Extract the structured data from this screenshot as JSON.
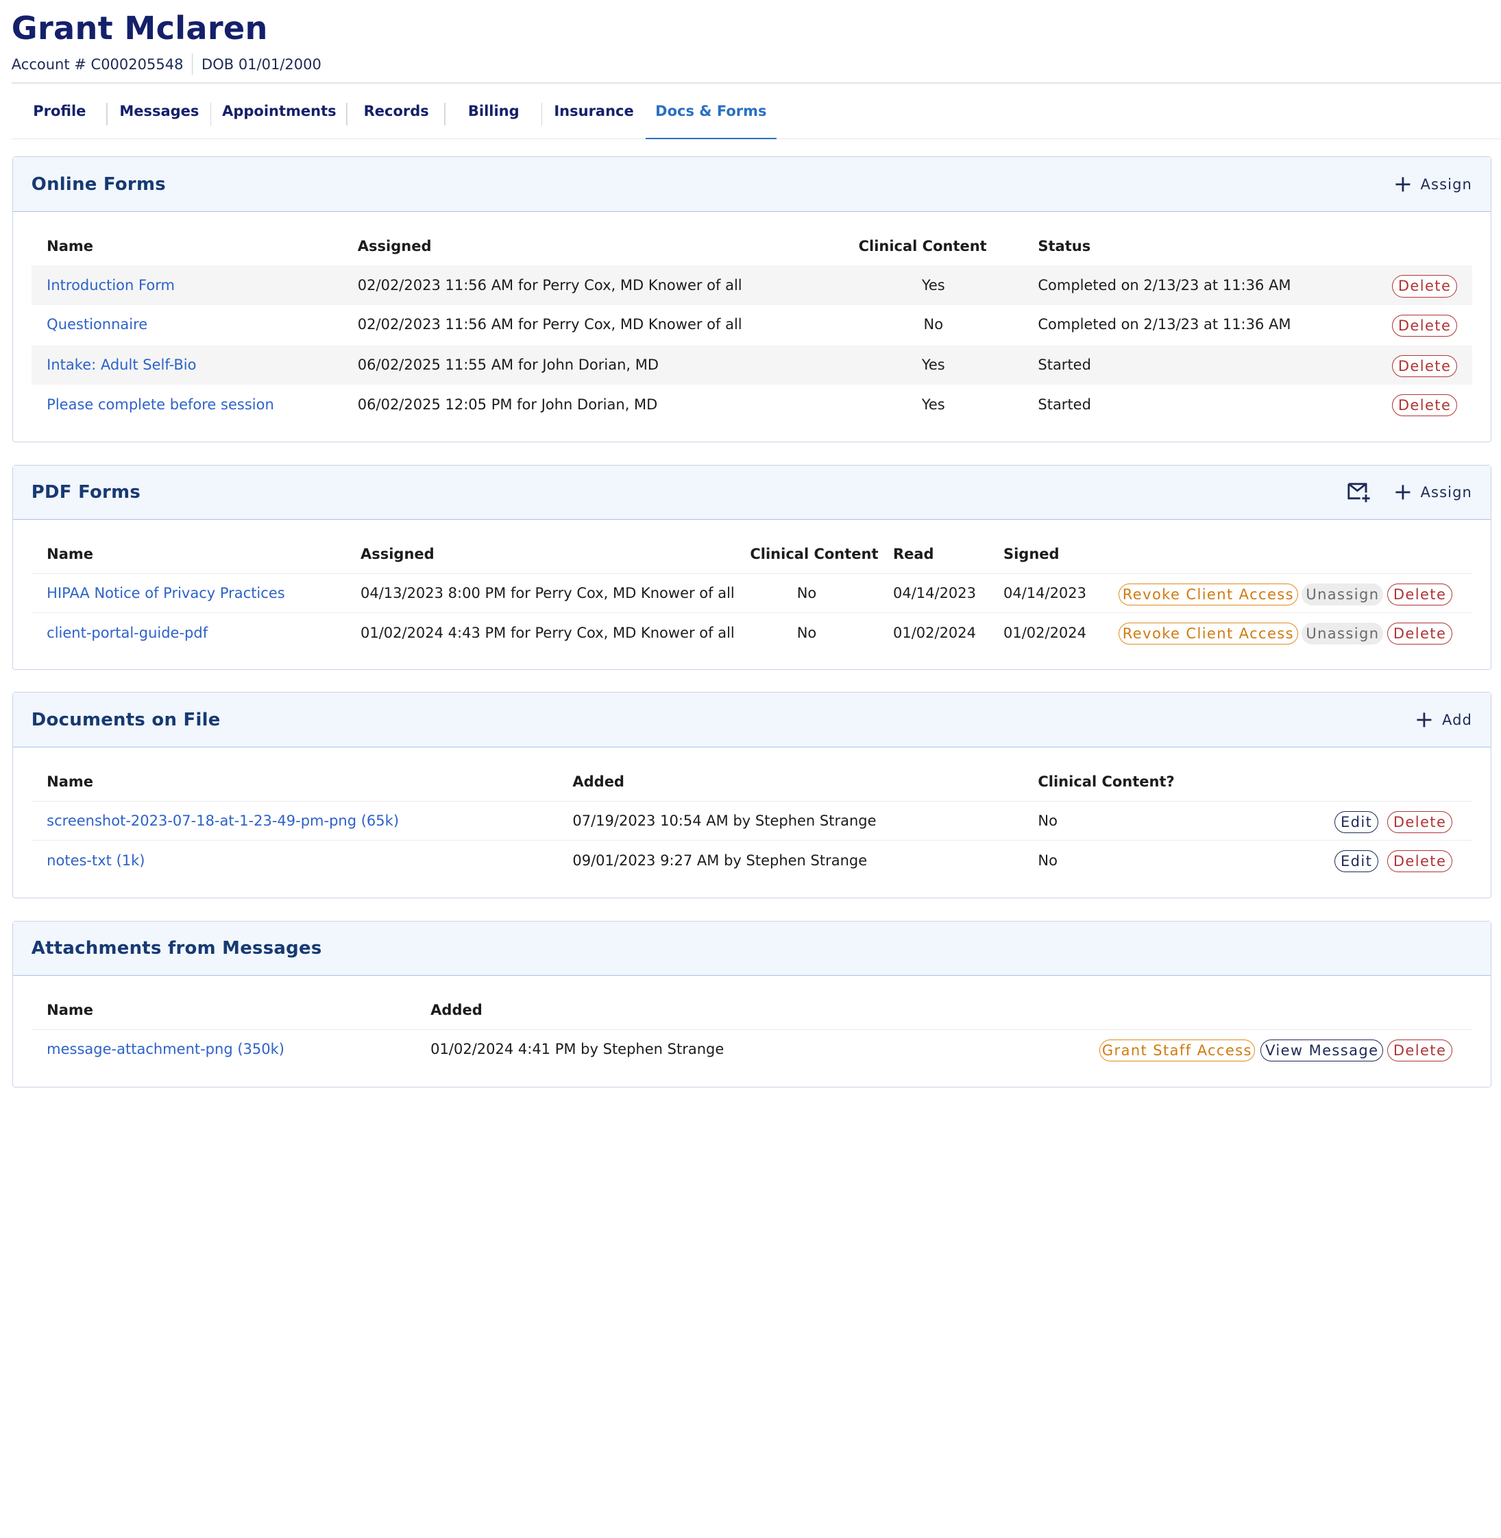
{
  "patient": {
    "name": "Grant Mclaren",
    "account": "Account # C000205548",
    "dob": "DOB 01/01/2000"
  },
  "tabs": [
    {
      "label": "Profile"
    },
    {
      "label": "Messages"
    },
    {
      "label": "Appointments"
    },
    {
      "label": "Records"
    },
    {
      "label": "Billing"
    },
    {
      "label": "Insurance"
    },
    {
      "label": "Docs & Forms",
      "active": true
    }
  ],
  "online_forms": {
    "title": "Online Forms",
    "assign_label": "Assign",
    "columns": {
      "name": "Name",
      "assigned": "Assigned",
      "clinical": "Clinical Content",
      "status": "Status"
    },
    "rows": [
      {
        "name": "Introduction Form",
        "assigned": "02/02/2023 11:56 AM for Perry Cox, MD Knower of all",
        "clinical": "Yes",
        "status": "Completed on 2/13/23 at 11:36 AM",
        "delete": "Delete"
      },
      {
        "name": "Questionnaire",
        "assigned": "02/02/2023 11:56 AM for Perry Cox, MD Knower of all",
        "clinical": "No",
        "status": "Completed on 2/13/23 at 11:36 AM",
        "delete": "Delete"
      },
      {
        "name": "Intake: Adult Self-Bio",
        "assigned": "06/02/2025 11:55 AM for John Dorian, MD",
        "clinical": "Yes",
        "status": "Started",
        "delete": "Delete"
      },
      {
        "name": "Please complete before session",
        "assigned": "06/02/2025 12:05 PM for John Dorian, MD",
        "clinical": "Yes",
        "status": "Started",
        "delete": "Delete"
      }
    ]
  },
  "pdf_forms": {
    "title": "PDF Forms",
    "assign_label": "Assign",
    "columns": {
      "name": "Name",
      "assigned": "Assigned",
      "clinical": "Clinical Content",
      "read": "Read",
      "signed": "Signed"
    },
    "rows": [
      {
        "name": "HIPAA Notice of Privacy Practices",
        "assigned": "04/13/2023 8:00 PM for Perry Cox, MD Knower of all",
        "clinical": "No",
        "read": "04/14/2023",
        "signed": "04/14/2023",
        "revoke": "Revoke Client Access",
        "unassign": "Unassign",
        "delete": "Delete"
      },
      {
        "name": "client-portal-guide-pdf",
        "assigned": "01/02/2024 4:43 PM for Perry Cox, MD Knower of all",
        "clinical": "No",
        "read": "01/02/2024",
        "signed": "01/02/2024",
        "revoke": "Revoke Client Access",
        "unassign": "Unassign",
        "delete": "Delete"
      }
    ]
  },
  "documents": {
    "title": "Documents on File",
    "add_label": "Add",
    "columns": {
      "name": "Name",
      "added": "Added",
      "clinical": "Clinical Content?"
    },
    "rows": [
      {
        "name": "screenshot-2023-07-18-at-1-23-49-pm-png (65k)",
        "added": "07/19/2023 10:54 AM by Stephen Strange",
        "clinical": "No",
        "edit": "Edit",
        "delete": "Delete"
      },
      {
        "name": "notes-txt (1k)",
        "added": "09/01/2023 9:27 AM by Stephen Strange",
        "clinical": "No",
        "edit": "Edit",
        "delete": "Delete"
      }
    ]
  },
  "attachments": {
    "title": "Attachments from Messages",
    "columns": {
      "name": "Name",
      "added": "Added"
    },
    "rows": [
      {
        "name": "message-attachment-png (350k)",
        "added": "01/02/2024 4:41 PM by Stephen Strange",
        "grant": "Grant Staff Access",
        "view": "View Message",
        "delete": "Delete"
      }
    ]
  }
}
